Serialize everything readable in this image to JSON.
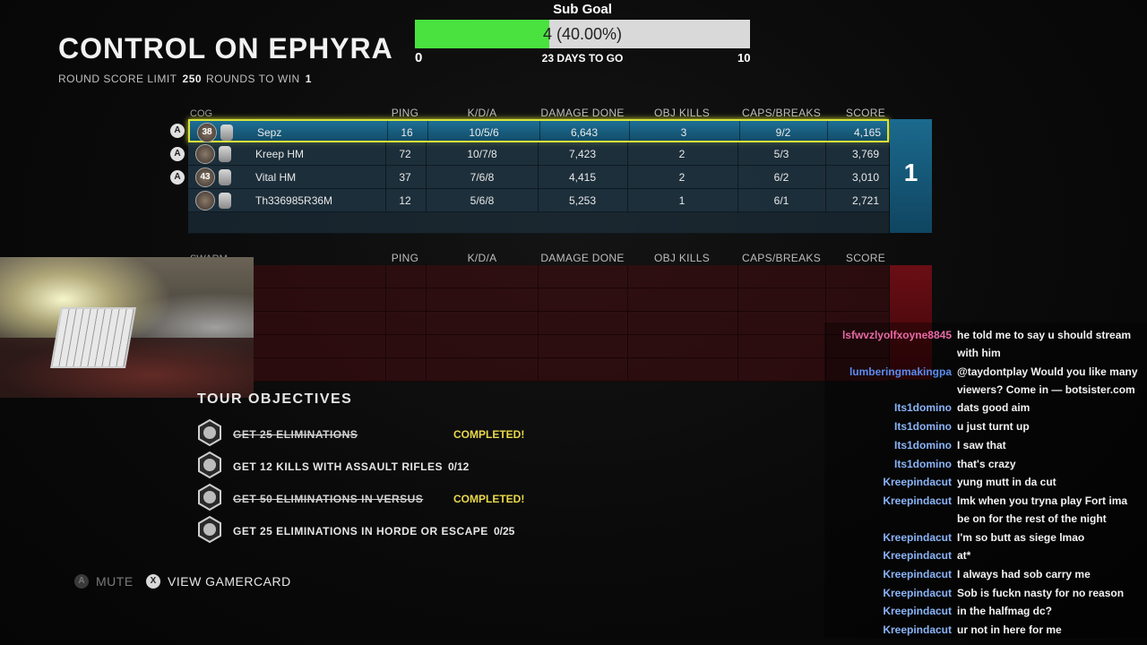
{
  "header": {
    "title": "CONTROL ON EPHYRA",
    "round_score_limit_label": "ROUND SCORE LIMIT",
    "round_score_limit": "250",
    "rounds_to_win_label": "ROUNDS TO WIN",
    "rounds_to_win": "1"
  },
  "sub_goal": {
    "title": "Sub Goal",
    "progress_text": "4 (40.00%)",
    "progress_fraction": 0.4,
    "min": "0",
    "max": "10",
    "days_text": "23 DAYS TO GO",
    "fill_color": "#49e23e"
  },
  "scoreboard": {
    "columns": [
      "PING",
      "K/D/A",
      "DAMAGE DONE",
      "OBJ KILLS",
      "CAPS/BREAKS",
      "SCORE"
    ],
    "cog": {
      "label": "COG",
      "rounds": "1",
      "color": "#1b6a8e",
      "players": [
        {
          "rank": "38",
          "name": "Sepz",
          "ping": "16",
          "kda": "10/5/6",
          "damage": "6,643",
          "obj_kills": "3",
          "caps": "9/2",
          "score": "4,165",
          "badge": "A"
        },
        {
          "rank": "",
          "name": "Kreep HM",
          "ping": "72",
          "kda": "10/7/8",
          "damage": "7,423",
          "obj_kills": "2",
          "caps": "5/3",
          "score": "3,769",
          "badge": "A"
        },
        {
          "rank": "43",
          "name": "Vital HM",
          "ping": "37",
          "kda": "7/6/8",
          "damage": "4,415",
          "obj_kills": "2",
          "caps": "6/2",
          "score": "3,010",
          "badge": "A"
        },
        {
          "rank": "",
          "name": "Th336985R36M",
          "ping": "12",
          "kda": "5/6/8",
          "damage": "5,253",
          "obj_kills": "1",
          "caps": "6/1",
          "score": "2,721",
          "badge": ""
        }
      ]
    },
    "swarm": {
      "label": "SWARM",
      "color": "#6a0e14"
    }
  },
  "objectives": {
    "title": "TOUR OBJECTIVES",
    "items": [
      {
        "text": "GET 25 ELIMINATIONS",
        "status": "COMPLETED!",
        "completed": true
      },
      {
        "text": "GET 12 KILLS WITH ASSAULT RIFLES",
        "status": "0/12",
        "completed": false
      },
      {
        "text": "GET 50 ELIMINATIONS IN VERSUS",
        "status": "COMPLETED!",
        "completed": true
      },
      {
        "text": "GET 25 ELIMINATIONS IN HORDE OR ESCAPE",
        "status": "0/25",
        "completed": false
      }
    ]
  },
  "controls": {
    "mute_button": "A",
    "mute_label": "MUTE",
    "gamercard_button": "X",
    "gamercard_label": "VIEW GAMERCARD"
  },
  "chat": [
    {
      "user": "lsfwvzlyolfxoyne8845",
      "color": "#e86aa6",
      "lines": [
        "he told me to say u should stream",
        "with him"
      ]
    },
    {
      "user": "lumberingmakingpa",
      "color": "#5b8cf0",
      "lines": [
        "@taydontplay Would you like many",
        "viewers? Come in — botsister.com"
      ]
    },
    {
      "user": "Its1domino",
      "color": "#8ab4f8",
      "lines": [
        "dats good aim"
      ]
    },
    {
      "user": "Its1domino",
      "color": "#8ab4f8",
      "lines": [
        "u just turnt up"
      ]
    },
    {
      "user": "Its1domino",
      "color": "#8ab4f8",
      "lines": [
        "I saw that"
      ]
    },
    {
      "user": "Its1domino",
      "color": "#8ab4f8",
      "lines": [
        "that's crazy"
      ]
    },
    {
      "user": "Kreepindacut",
      "color": "#8ab4f8",
      "lines": [
        "yung mutt in da cut"
      ]
    },
    {
      "user": "Kreepindacut",
      "color": "#8ab4f8",
      "lines": [
        "lmk when you tryna play Fort ima",
        "be on for the rest of the night"
      ]
    },
    {
      "user": "Kreepindacut",
      "color": "#8ab4f8",
      "lines": [
        "I'm so butt as siege lmao"
      ]
    },
    {
      "user": "Kreepindacut",
      "color": "#8ab4f8",
      "lines": [
        "at*"
      ]
    },
    {
      "user": "Kreepindacut",
      "color": "#8ab4f8",
      "lines": [
        "I always had sob carry me"
      ]
    },
    {
      "user": "Kreepindacut",
      "color": "#8ab4f8",
      "lines": [
        "Sob is fuckn nasty for no reason"
      ]
    },
    {
      "user": "Kreepindacut",
      "color": "#8ab4f8",
      "lines": [
        "in the halfmag dc?"
      ]
    },
    {
      "user": "Kreepindacut",
      "color": "#8ab4f8",
      "lines": [
        "ur not in here for me"
      ]
    }
  ]
}
